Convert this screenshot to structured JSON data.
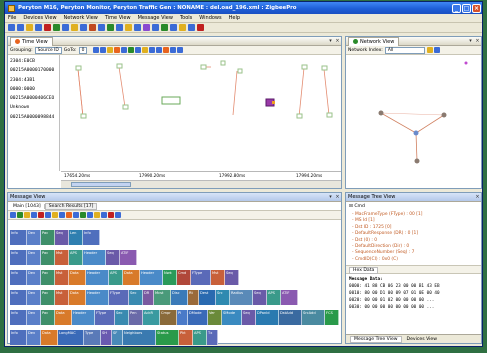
{
  "window": {
    "title": "Peryton M16, Peryton Monitor, Peryton Traffic Gen : NONAME : del.oad_196.xml : ZigbeePro",
    "minimize": "_",
    "maximize": "□",
    "close": "×"
  },
  "menu": [
    "File",
    "Devices View",
    "Network View",
    "Time View",
    "Message View",
    "Tools",
    "Windows",
    "Help"
  ],
  "toolbar_colors": [
    "#3b6bd6",
    "#3b6bd6",
    "#e0b020",
    "#3b6bd6",
    "#c02020",
    "#2a8a2a",
    "#3b6bd6",
    "#e0b020",
    "#3b6bd6",
    "#c04a20",
    "#3b6bd6",
    "#2a8a2a",
    "#3b6bd6",
    "#e0b020",
    "#3b6bd6",
    "#8a4ad0",
    "#3b6bd6",
    "#2a8a2a",
    "#3b6bd6",
    "#e0b020",
    "#3b6bd6",
    "#c02020"
  ],
  "time_view": {
    "tab": "Time View",
    "grouping_label": "Grouping:",
    "grouping_value": "Source ID",
    "goto_label": "GoTo:",
    "goto_value": "0",
    "nodes": [
      "2304:E0CB",
      "00215A0000170000",
      "2304:43B1",
      "0000:0000",
      "00215A0000406CEO",
      "Unknown",
      "00215A0000098844"
    ],
    "axis_ticks": [
      "17654.20ms",
      "17990.20ms",
      "17992.80ms",
      "17994.20ms"
    ]
  },
  "network_view": {
    "tab": "Network View",
    "index_label": "Network Index:",
    "index_value": "All"
  },
  "message_view": {
    "title": "Message View",
    "tab_main": "Main [1043]",
    "tab_search": "Search Results [17]",
    "rows": [
      [
        "Info",
        "Dev",
        "Pac",
        "Seq",
        "Len",
        "Info"
      ],
      [
        "Info",
        "Dev",
        "Pac",
        "Mst",
        "APS",
        "Header",
        "Seq",
        "ATIF"
      ],
      [
        "Info",
        "Dev",
        "Pac",
        "Mst",
        "Data",
        "Header",
        "APS",
        "Data",
        "Header",
        "Nwk",
        "Cmd",
        "FType",
        "Mst",
        "Seq"
      ],
      [
        "Info",
        "Dev",
        "Pac",
        "Mst",
        "Data",
        "Header",
        "FType",
        "Sec",
        "DR",
        "Mcst",
        "Disc",
        "Rt",
        "Dest",
        "Src",
        "Radius",
        "Seq",
        "APS",
        "ATIF"
      ],
      [
        "Info",
        "Dev",
        "Pac",
        "Data",
        "Header",
        "FType",
        "Sec",
        "Pen",
        "AckR",
        "Cmpr",
        "PI",
        "DMode",
        "Ver",
        "SMode",
        "Seq",
        "DPanId",
        "DstAdd",
        "SrcAdd",
        "FCS"
      ],
      [
        "Info",
        "Dev",
        "Data",
        "LongMAC",
        "Type",
        "SH",
        "SF",
        "Neighbors",
        "Status",
        "Pkt",
        "APS",
        "Tx"
      ]
    ]
  },
  "message_tree": {
    "title": "Message Tree View",
    "root": "Cmd",
    "items": [
      "MacFrameType (FType) : 00 [1]",
      "MS Id [1]",
      "Dst ID : 1725 [0]",
      "DefaultResponse (DR) : 0 [1]",
      "Dst (0) : 0",
      "DefaultDirection (Dir) : 0",
      "SequenceNumber (Seq) : 7",
      "CmdID(CI) : 0x0 (C)"
    ],
    "hex_tab": "Hex Data",
    "hex_header": "Message Data:",
    "hex_lines": [
      "0000: 41 88 CB 06 23 00 00 B1 43 EB",
      "0010: 80 00 D1 00 09 07 01 0E 00 40",
      "0020: 00 00 01 02 00 00 00 00 ...",
      "0030: 00 00 00 00 00 00 00 00 ..."
    ],
    "footer_tab1": "Message Tree View",
    "footer_tab2": "Devices View"
  }
}
